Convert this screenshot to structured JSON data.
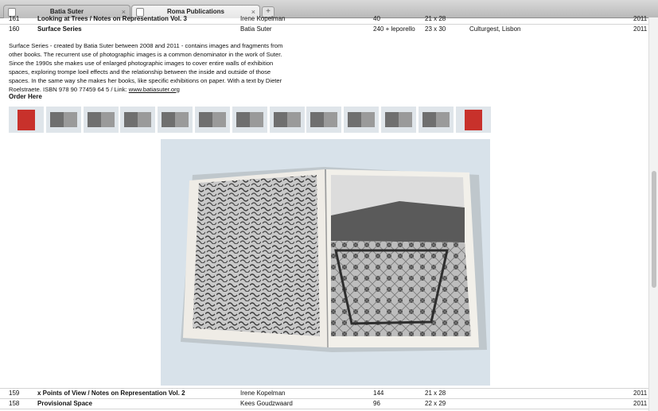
{
  "tabs": [
    {
      "label": "Batia Suter",
      "active": false
    },
    {
      "label": "Roma Publications",
      "active": true
    }
  ],
  "new_tab_label": "+",
  "tab_close_glyph": "×",
  "rows": {
    "r161": {
      "num": "161",
      "title": "Looking at Trees / Notes on Representation Vol. 3",
      "author": "Irene Kopelman",
      "pages": "40",
      "size": "21 x 28",
      "publisher": "",
      "year": "2011"
    },
    "r160": {
      "num": "160",
      "title": "Surface Series",
      "author": "Batia Suter",
      "pages": "240 + leporello",
      "size": "23 x 30",
      "publisher": "Culturgest, Lisbon",
      "year": "2011"
    },
    "r159": {
      "num": "159",
      "title": "x Points of View / Notes on Representation Vol. 2",
      "author": "Irene Kopelman",
      "pages": "144",
      "size": "21 x 28",
      "publisher": "",
      "year": "2011"
    },
    "r158": {
      "num": "158",
      "title": "Provisional Space",
      "author": "Kees Goudzwaard",
      "pages": "96",
      "size": "22 x 29",
      "publisher": "",
      "year": "2011"
    }
  },
  "description": {
    "text": "Surface Series - created by Batia Suter between 2008 and 2011 - contains images and fragments from other books. The recurrent use of photographic images is a common denominator in the work of Suter. Since the 1990s she makes use of enlarged photographic images to cover entire walls of exhibition spaces, exploring trompe loeil effects and the relationship between the inside and outside of those spaces. In the same way she makes her books, like specific exhibitions on paper. With a text by Dieter Roelstraete. ISBN 978 90 77459 64 5 / Link: ",
    "link": "www.batiasuter.org",
    "order_label": "Order Here"
  },
  "thumbnails": [
    {
      "kind": "red-cover"
    },
    {
      "kind": "spread"
    },
    {
      "kind": "spread"
    },
    {
      "kind": "spread"
    },
    {
      "kind": "spread"
    },
    {
      "kind": "spread"
    },
    {
      "kind": "spread"
    },
    {
      "kind": "spread"
    },
    {
      "kind": "spread"
    },
    {
      "kind": "spread"
    },
    {
      "kind": "spread"
    },
    {
      "kind": "spread"
    },
    {
      "kind": "red-cover"
    }
  ],
  "colors": {
    "cover_red": "#c8312b",
    "photo_bg": "#d8e2ea",
    "rule": "#d4d4d4"
  }
}
